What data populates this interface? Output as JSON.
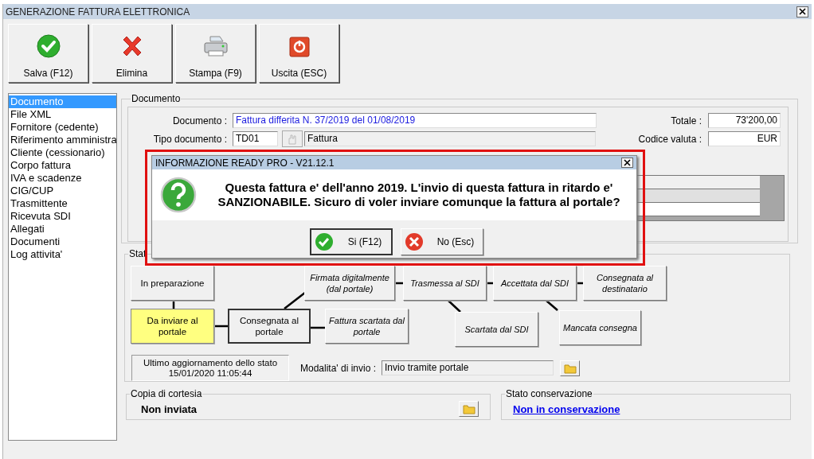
{
  "window": {
    "title": "GENERAZIONE FATTURA ELETTRONICA"
  },
  "toolbar": [
    {
      "label": "Salva (F12)",
      "kind": "save"
    },
    {
      "label": "Elimina",
      "kind": "delete"
    },
    {
      "label": "Stampa (F9)",
      "kind": "print"
    },
    {
      "label": "Uscita (ESC)",
      "kind": "exit"
    }
  ],
  "sidebar": {
    "items": [
      {
        "label": "Documento",
        "selected": true
      },
      {
        "label": "File XML",
        "selected": false
      },
      {
        "label": "Fornitore (cedente)",
        "selected": false
      },
      {
        "label": "Riferimento amministra",
        "selected": false
      },
      {
        "label": "Cliente (cessionario)",
        "selected": false
      },
      {
        "label": "Corpo fattura",
        "selected": false
      },
      {
        "label": "IVA e scadenze",
        "selected": false
      },
      {
        "label": "CIG/CUP",
        "selected": false
      },
      {
        "label": "Trasmittente",
        "selected": false
      },
      {
        "label": "Ricevuta SDI",
        "selected": false
      },
      {
        "label": "Allegati",
        "selected": false
      },
      {
        "label": "Documenti",
        "selected": false
      },
      {
        "label": "Log attivita'",
        "selected": false
      }
    ]
  },
  "documento": {
    "title": "Documento",
    "documento_label": "Documento :",
    "documento_value": "Fattura differita N. 37/2019 del 01/08/2019",
    "tipo_label": "Tipo documento :",
    "tipo_code": "TD01",
    "tipo_desc": "Fattura",
    "totale_label": "Totale :",
    "totale_value": "73'200,00",
    "valuta_label": "Codice valuta :",
    "valuta_value": "EUR"
  },
  "stato": {
    "title": "Stat",
    "nodes": [
      {
        "label": "In preparazione",
        "reached": true,
        "current": false,
        "highlighted": false
      },
      {
        "label": "Firmata digitalmente (dal portale)",
        "reached": false,
        "current": false,
        "highlighted": false
      },
      {
        "label": "Trasmessa al SDI",
        "reached": false,
        "current": false,
        "highlighted": false
      },
      {
        "label": "Accettata dal SDI",
        "reached": false,
        "current": false,
        "highlighted": false
      },
      {
        "label": "Consegnata al destinatario",
        "reached": false,
        "current": false,
        "highlighted": false
      },
      {
        "label": "Da inviare al portale",
        "reached": true,
        "current": true,
        "highlighted": false
      },
      {
        "label": "Consegnata al portale",
        "reached": true,
        "current": false,
        "highlighted": true
      },
      {
        "label": "Fattura scartata dal portale",
        "reached": false,
        "current": false,
        "highlighted": false
      },
      {
        "label": "Scartata dal SDI",
        "reached": false,
        "current": false,
        "highlighted": false
      },
      {
        "label": "Mancata consegna",
        "reached": false,
        "current": false,
        "highlighted": false
      }
    ],
    "update_title": "Ultimo aggiornamento dello stato",
    "update_time": "15/01/2020 11:05:44",
    "mode_label": "Modalita' di invio :",
    "mode_value": "Invio tramite portale"
  },
  "copia": {
    "title": "Copia di cortesia",
    "value": "Non inviata"
  },
  "conservazione": {
    "title": "Stato conservazione",
    "link": "Non in conservazione"
  },
  "dialog": {
    "title": "INFORMAZIONE READY PRO - V21.12.1",
    "message": "Questa fattura e' dell'anno 2019. L'invio di questa fattura in ritardo e' SANZIONABILE. Sicuro di voler inviare comunque la fattura al portale?",
    "buttons": [
      {
        "label": "Si (F12)",
        "kind": "ok"
      },
      {
        "label": "No (Esc)",
        "kind": "cancel"
      }
    ]
  }
}
